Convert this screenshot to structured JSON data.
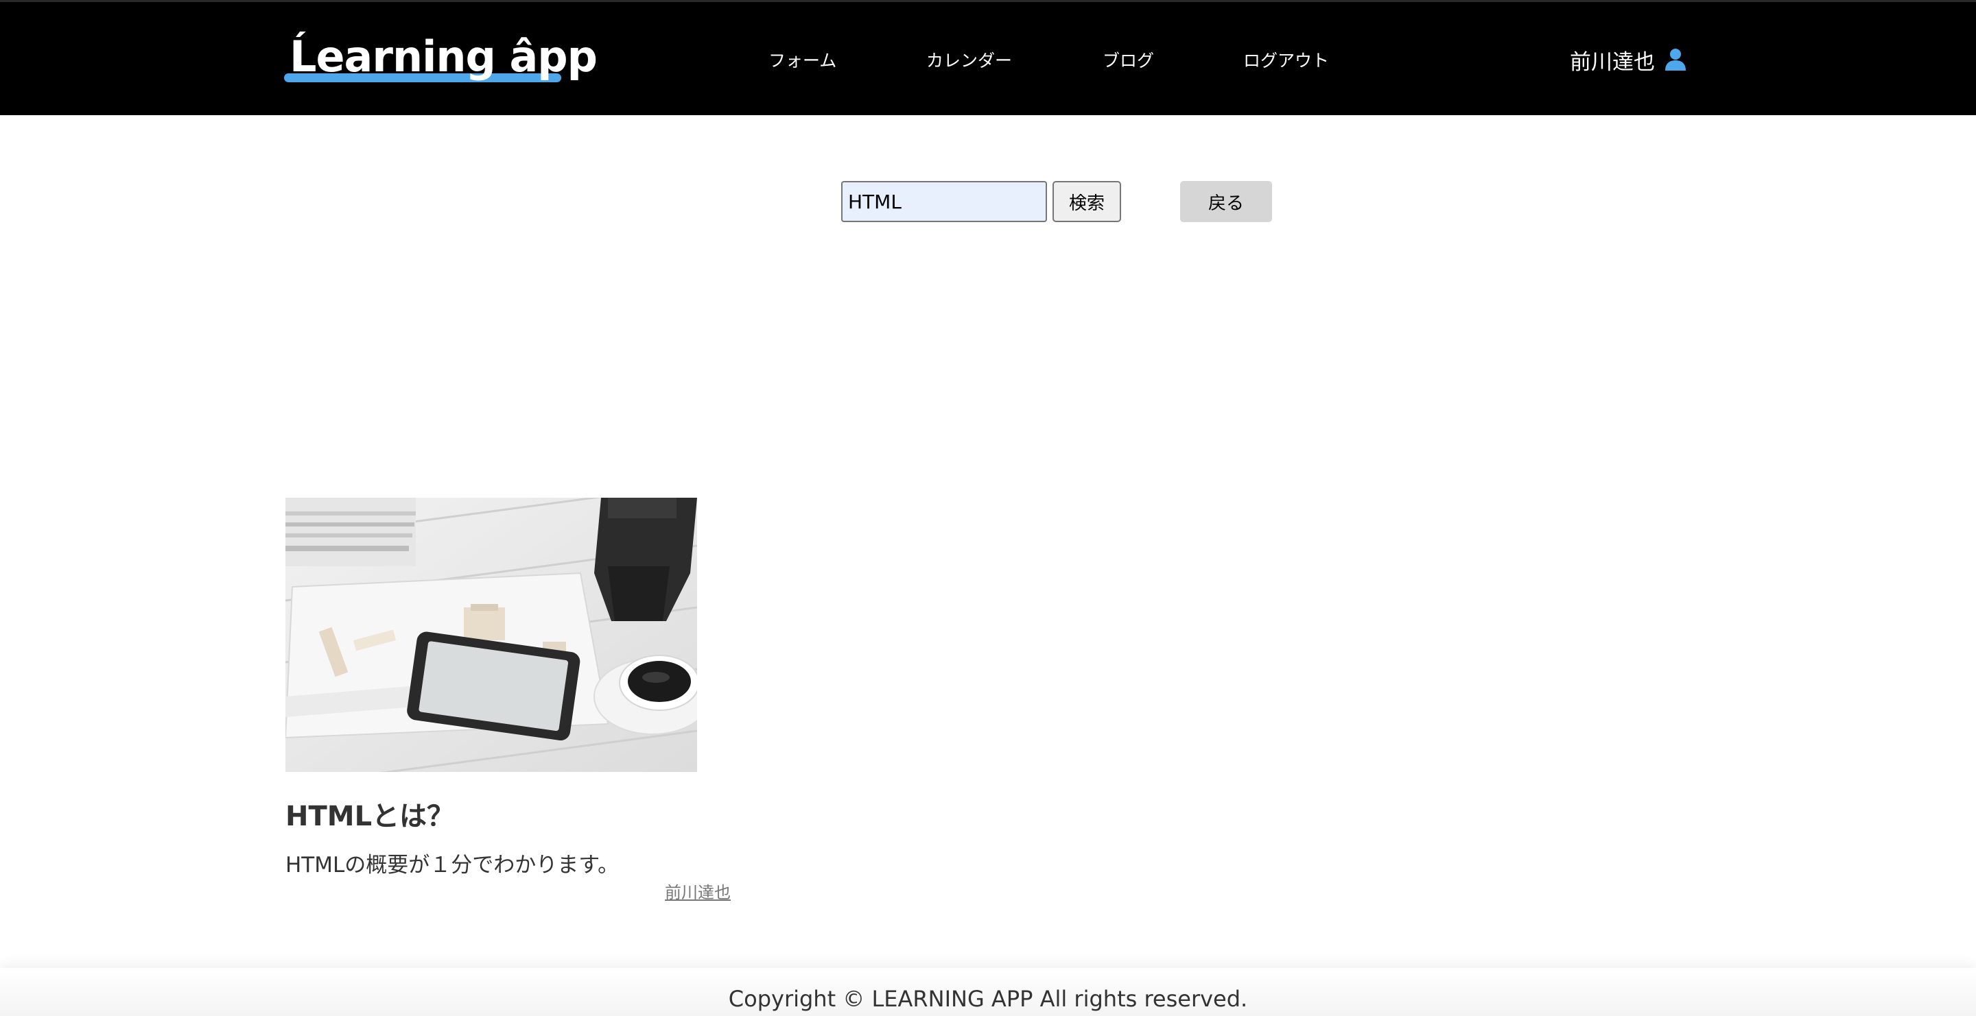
{
  "header": {
    "logo_text": "Ĺearning âpp",
    "nav": [
      {
        "label": "フォーム"
      },
      {
        "label": "カレンダー"
      },
      {
        "label": "ブログ"
      },
      {
        "label": "ログアウト"
      }
    ],
    "user_name": "前川達也",
    "user_icon": "user-icon"
  },
  "search": {
    "value": "HTML",
    "search_button_label": "検索",
    "back_button_label": "戻る"
  },
  "results": [
    {
      "image_icon": "photo-tablet-coffee",
      "title": "HTMLとは？",
      "description": "HTMLの概要が１分でわかります。",
      "author": "前川達也"
    }
  ],
  "footer": {
    "copyright": "Copyright © LEARNING APP All rights reserved."
  },
  "colors": {
    "header_bg": "#000000",
    "accent": "#4ea7ea",
    "input_bg": "#e8f0fe",
    "text": "#333333"
  }
}
